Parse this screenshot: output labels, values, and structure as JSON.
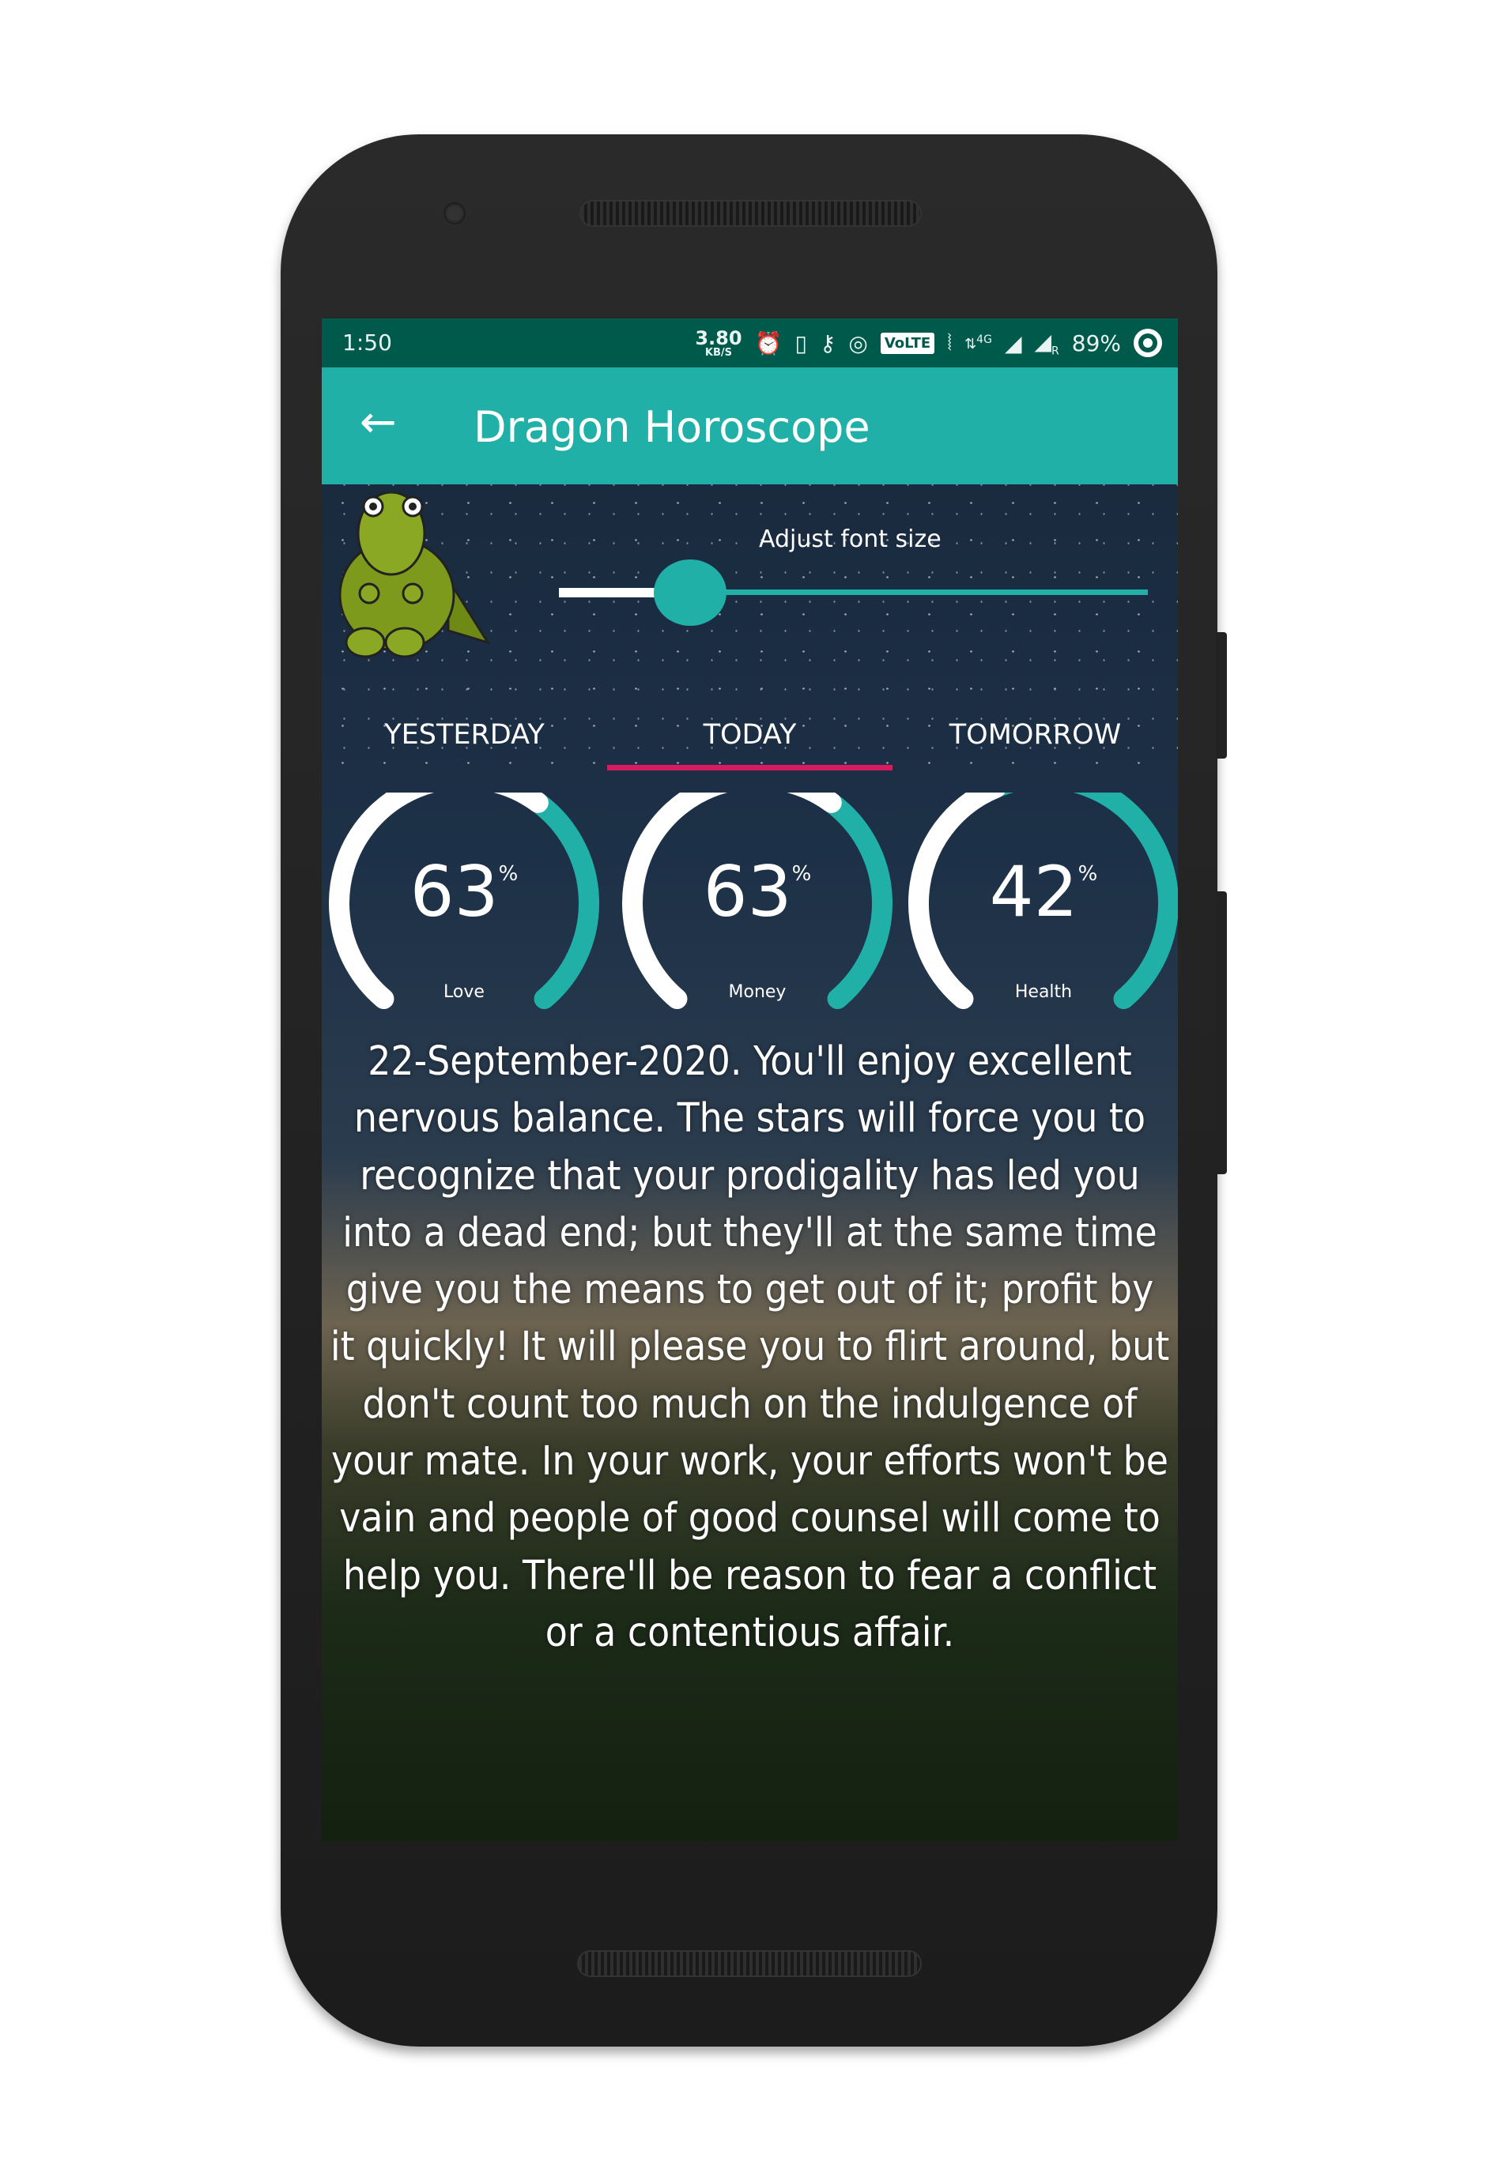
{
  "status_bar": {
    "time": "1:50",
    "speed_value": "3.80",
    "speed_unit": "KB/S",
    "volte": "VoLTE",
    "network": "4G",
    "roaming": "R",
    "battery": "89%",
    "icons": [
      "alarm-icon",
      "phone-icon",
      "key-icon",
      "hotspot-icon",
      "volte-icon",
      "vibrate-icon",
      "data-arrows-icon",
      "signal-icon",
      "signal-roaming-icon",
      "battery-saver-icon"
    ]
  },
  "app_bar": {
    "back_icon": "arrow-left-icon",
    "title": "Dragon Horoscope"
  },
  "font_size": {
    "label": "Adjust font size",
    "value_percent": 17
  },
  "tabs": [
    {
      "label": "YESTERDAY"
    },
    {
      "label": "TODAY",
      "active": true
    },
    {
      "label": "TOMORROW"
    }
  ],
  "gauges": [
    {
      "value": "63",
      "unit": "%",
      "label": "Love",
      "percent": 63
    },
    {
      "value": "63",
      "unit": "%",
      "label": "Money",
      "percent": 63
    },
    {
      "value": "42",
      "unit": "%",
      "label": "Health",
      "percent": 42
    }
  ],
  "reading": "22-September-2020. You'll enjoy excellent nervous balance. The stars will force you to recognize that your prodigality has led you into a dead end; but they'll at the same time give you the means to get out of it; profit by it quickly! It will please you to flirt around, but don't count too much on the indulgence of your mate. In your work, your efforts won't be vain and people of good counsel will come to help you. There'll be reason to fear a conflict or a contentious affair.",
  "colors": {
    "status_bar": "#005a4c",
    "accent": "#21b0a8",
    "tab_indicator": "#d81b60"
  }
}
